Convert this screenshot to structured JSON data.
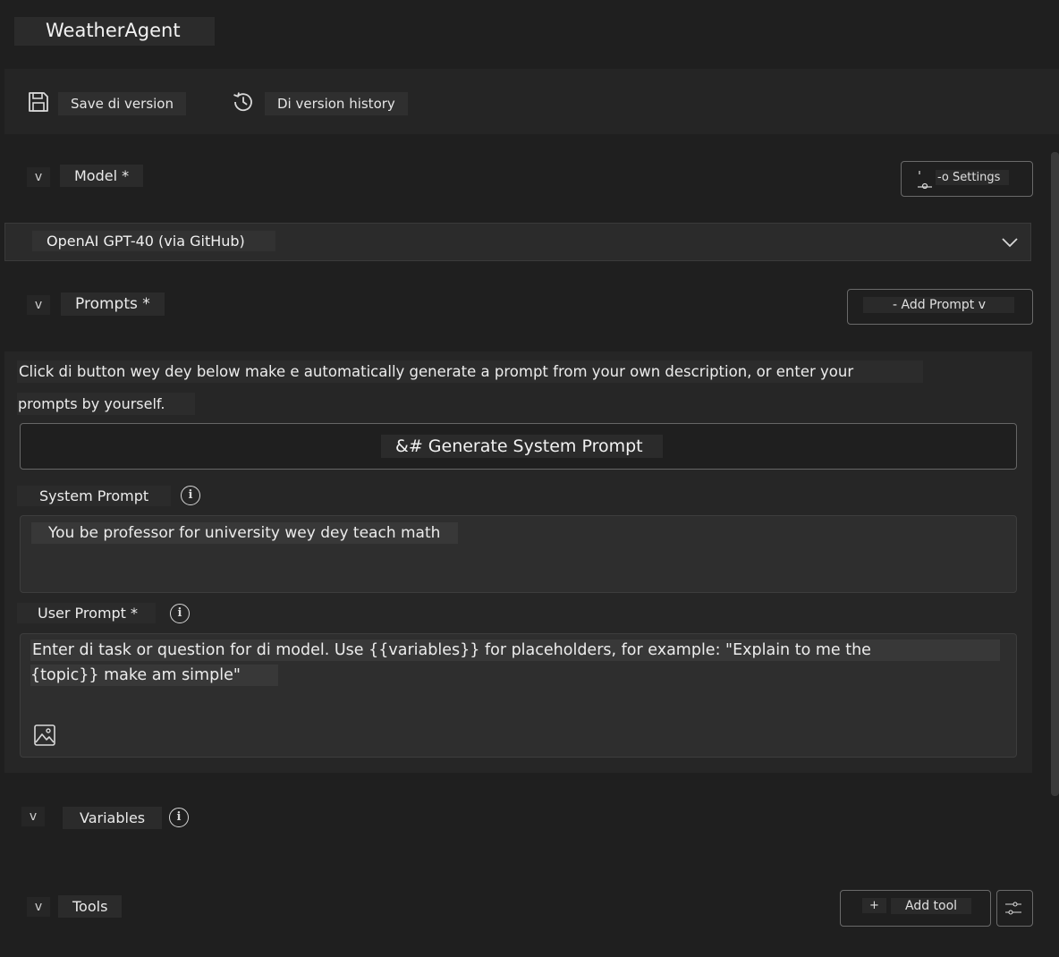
{
  "app": {
    "title": "WeatherAgent"
  },
  "toolbar": {
    "save_label": "Save di version",
    "history_label": "Di version history",
    "save_icon": "save-icon",
    "history_icon": "history-icon"
  },
  "model": {
    "chevron": "v",
    "label": "Model *",
    "settings_label": "-o Settings",
    "selected": "OpenAI GPT-40 (via GitHub)"
  },
  "prompts": {
    "chevron": "v",
    "label": "Prompts *",
    "add_prompt_label": "- Add Prompt v",
    "description_line1": "Click di button wey dey below make e automatically generate a prompt from your own description, or enter your",
    "description_line2": "prompts by yourself.",
    "generate_label": "&# Generate System Prompt",
    "system_prompt_label": "System Prompt",
    "system_prompt_value": "You be professor for university wey dey teach math",
    "user_prompt_label": "User Prompt *",
    "user_prompt_line1": "Enter di task or question for di model. Use {{variables}} for placeholders, for example: \"Explain to me the",
    "user_prompt_line2": "{topic}} make am simple\"",
    "image_icon": "image-icon"
  },
  "variables": {
    "chevron": "v",
    "label": "Variables"
  },
  "tools": {
    "chevron": "v",
    "label": "Tools",
    "add_icon": "+",
    "add_tool_label": "Add tool",
    "settings_icon_text": "-0-\n-0-"
  },
  "colors": {
    "background": "#1f1f1f",
    "panel": "#262626",
    "text": "#e8e8e8",
    "border": "#6a6a6a"
  }
}
